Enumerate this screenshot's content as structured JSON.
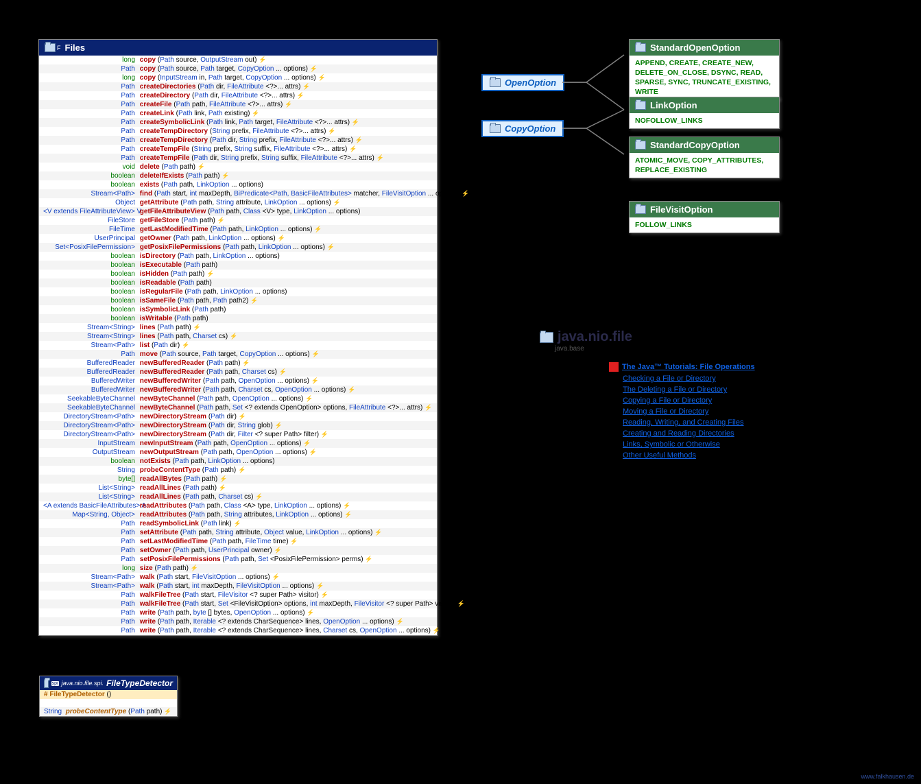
{
  "package": {
    "name": "java.nio.file",
    "module": "java.base"
  },
  "files_class": {
    "name": "Files",
    "marker": "F"
  },
  "methods": [
    {
      "ret": "long",
      "name": "copy",
      "params": [
        [
          "Path",
          "source"
        ],
        [
          "OutputStream",
          "out"
        ]
      ],
      "th": true
    },
    {
      "ret": "Path",
      "name": "copy",
      "params": [
        [
          "Path",
          "source"
        ],
        [
          "Path",
          "target"
        ],
        [
          "CopyOption",
          "... options"
        ]
      ],
      "th": true
    },
    {
      "ret": "long",
      "name": "copy",
      "params": [
        [
          "InputStream",
          "in"
        ],
        [
          "Path",
          "target"
        ],
        [
          "CopyOption",
          "... options"
        ]
      ],
      "th": true
    },
    {
      "ret": "Path",
      "name": "createDirectories",
      "params": [
        [
          "Path",
          "dir"
        ],
        [
          "FileAttribute",
          "<?>... attrs"
        ]
      ],
      "th": true
    },
    {
      "ret": "Path",
      "name": "createDirectory",
      "params": [
        [
          "Path",
          "dir"
        ],
        [
          "FileAttribute",
          "<?>... attrs"
        ]
      ],
      "th": true
    },
    {
      "ret": "Path",
      "name": "createFile",
      "params": [
        [
          "Path",
          "path"
        ],
        [
          "FileAttribute",
          "<?>... attrs"
        ]
      ],
      "th": true
    },
    {
      "ret": "Path",
      "name": "createLink",
      "params": [
        [
          "Path",
          "link"
        ],
        [
          "Path",
          "existing"
        ]
      ],
      "th": true
    },
    {
      "ret": "Path",
      "name": "createSymbolicLink",
      "params": [
        [
          "Path",
          "link"
        ],
        [
          "Path",
          "target"
        ],
        [
          "FileAttribute",
          "<?>... attrs"
        ]
      ],
      "th": true
    },
    {
      "ret": "Path",
      "name": "createTempDirectory",
      "params": [
        [
          "String",
          "prefix"
        ],
        [
          "FileAttribute",
          "<?>... attrs"
        ]
      ],
      "th": true
    },
    {
      "ret": "Path",
      "name": "createTempDirectory",
      "params": [
        [
          "Path",
          "dir"
        ],
        [
          "String",
          "prefix"
        ],
        [
          "FileAttribute",
          "<?>... attrs"
        ]
      ],
      "th": true
    },
    {
      "ret": "Path",
      "name": "createTempFile",
      "params": [
        [
          "String",
          "prefix"
        ],
        [
          "String",
          "suffix"
        ],
        [
          "FileAttribute",
          "<?>... attrs"
        ]
      ],
      "th": true
    },
    {
      "ret": "Path",
      "name": "createTempFile",
      "params": [
        [
          "Path",
          "dir"
        ],
        [
          "String",
          "prefix"
        ],
        [
          "String",
          "suffix"
        ],
        [
          "FileAttribute",
          "<?>... attrs"
        ]
      ],
      "th": true
    },
    {
      "ret": "void",
      "name": "delete",
      "params": [
        [
          "Path",
          "path"
        ]
      ],
      "th": true
    },
    {
      "ret": "boolean",
      "name": "deleteIfExists",
      "params": [
        [
          "Path",
          "path"
        ]
      ],
      "th": true
    },
    {
      "ret": "boolean",
      "name": "exists",
      "params": [
        [
          "Path",
          "path"
        ],
        [
          "LinkOption",
          "... options"
        ]
      ],
      "th": false
    },
    {
      "ret": "Stream<Path>",
      "name": "find",
      "params": [
        [
          "Path",
          "start"
        ],
        [
          "int",
          "maxDepth"
        ],
        [
          "BiPredicate<Path, BasicFileAttributes>",
          "matcher"
        ],
        [
          "FileVisitOption",
          "... options"
        ]
      ],
      "th": true
    },
    {
      "ret": "Object",
      "name": "getAttribute",
      "params": [
        [
          "Path",
          "path"
        ],
        [
          "String",
          "attribute"
        ],
        [
          "LinkOption",
          "... options"
        ]
      ],
      "th": true
    },
    {
      "ret": "<V extends FileAttributeView> V",
      "name": "getFileAttributeView",
      "params": [
        [
          "Path",
          "path"
        ],
        [
          "Class",
          "<V> type"
        ],
        [
          "LinkOption",
          "... options"
        ]
      ],
      "th": false
    },
    {
      "ret": "FileStore",
      "name": "getFileStore",
      "params": [
        [
          "Path",
          "path"
        ]
      ],
      "th": true
    },
    {
      "ret": "FileTime",
      "name": "getLastModifiedTime",
      "params": [
        [
          "Path",
          "path"
        ],
        [
          "LinkOption",
          "... options"
        ]
      ],
      "th": true
    },
    {
      "ret": "UserPrincipal",
      "name": "getOwner",
      "params": [
        [
          "Path",
          "path"
        ],
        [
          "LinkOption",
          "... options"
        ]
      ],
      "th": true
    },
    {
      "ret": "Set<PosixFilePermission>",
      "name": "getPosixFilePermissions",
      "params": [
        [
          "Path",
          "path"
        ],
        [
          "LinkOption",
          "... options"
        ]
      ],
      "th": true
    },
    {
      "ret": "boolean",
      "name": "isDirectory",
      "params": [
        [
          "Path",
          "path"
        ],
        [
          "LinkOption",
          "... options"
        ]
      ],
      "th": false
    },
    {
      "ret": "boolean",
      "name": "isExecutable",
      "params": [
        [
          "Path",
          "path"
        ]
      ],
      "th": false
    },
    {
      "ret": "boolean",
      "name": "isHidden",
      "params": [
        [
          "Path",
          "path"
        ]
      ],
      "th": true
    },
    {
      "ret": "boolean",
      "name": "isReadable",
      "params": [
        [
          "Path",
          "path"
        ]
      ],
      "th": false
    },
    {
      "ret": "boolean",
      "name": "isRegularFile",
      "params": [
        [
          "Path",
          "path"
        ],
        [
          "LinkOption",
          "... options"
        ]
      ],
      "th": false
    },
    {
      "ret": "boolean",
      "name": "isSameFile",
      "params": [
        [
          "Path",
          "path"
        ],
        [
          "Path",
          "path2"
        ]
      ],
      "th": true
    },
    {
      "ret": "boolean",
      "name": "isSymbolicLink",
      "params": [
        [
          "Path",
          "path"
        ]
      ],
      "th": false
    },
    {
      "ret": "boolean",
      "name": "isWritable",
      "params": [
        [
          "Path",
          "path"
        ]
      ],
      "th": false
    },
    {
      "ret": "Stream<String>",
      "name": "lines",
      "params": [
        [
          "Path",
          "path"
        ]
      ],
      "th": true
    },
    {
      "ret": "Stream<String>",
      "name": "lines",
      "params": [
        [
          "Path",
          "path"
        ],
        [
          "Charset",
          "cs"
        ]
      ],
      "th": true
    },
    {
      "ret": "Stream<Path>",
      "name": "list",
      "params": [
        [
          "Path",
          "dir"
        ]
      ],
      "th": true
    },
    {
      "ret": "Path",
      "name": "move",
      "params": [
        [
          "Path",
          "source"
        ],
        [
          "Path",
          "target"
        ],
        [
          "CopyOption",
          "... options"
        ]
      ],
      "th": true
    },
    {
      "ret": "BufferedReader",
      "name": "newBufferedReader",
      "params": [
        [
          "Path",
          "path"
        ]
      ],
      "th": true
    },
    {
      "ret": "BufferedReader",
      "name": "newBufferedReader",
      "params": [
        [
          "Path",
          "path"
        ],
        [
          "Charset",
          "cs"
        ]
      ],
      "th": true
    },
    {
      "ret": "BufferedWriter",
      "name": "newBufferedWriter",
      "params": [
        [
          "Path",
          "path"
        ],
        [
          "OpenOption",
          "... options"
        ]
      ],
      "th": true
    },
    {
      "ret": "BufferedWriter",
      "name": "newBufferedWriter",
      "params": [
        [
          "Path",
          "path"
        ],
        [
          "Charset",
          "cs"
        ],
        [
          "OpenOption",
          "... options"
        ]
      ],
      "th": true
    },
    {
      "ret": "SeekableByteChannel",
      "name": "newByteChannel",
      "params": [
        [
          "Path",
          "path"
        ],
        [
          "OpenOption",
          "... options"
        ]
      ],
      "th": true
    },
    {
      "ret": "SeekableByteChannel",
      "name": "newByteChannel",
      "params": [
        [
          "Path",
          "path"
        ],
        [
          "Set",
          "<? extends OpenOption> options"
        ],
        [
          "FileAttribute",
          "<?>... attrs"
        ]
      ],
      "th": true
    },
    {
      "ret": "DirectoryStream<Path>",
      "name": "newDirectoryStream",
      "params": [
        [
          "Path",
          "dir"
        ]
      ],
      "th": true
    },
    {
      "ret": "DirectoryStream<Path>",
      "name": "newDirectoryStream",
      "params": [
        [
          "Path",
          "dir"
        ],
        [
          "String",
          "glob"
        ]
      ],
      "th": true
    },
    {
      "ret": "DirectoryStream<Path>",
      "name": "newDirectoryStream",
      "params": [
        [
          "Path",
          "dir"
        ],
        [
          "Filter",
          "<? super Path> filter"
        ]
      ],
      "th": true
    },
    {
      "ret": "InputStream",
      "name": "newInputStream",
      "params": [
        [
          "Path",
          "path"
        ],
        [
          "OpenOption",
          "... options"
        ]
      ],
      "th": true
    },
    {
      "ret": "OutputStream",
      "name": "newOutputStream",
      "params": [
        [
          "Path",
          "path"
        ],
        [
          "OpenOption",
          "... options"
        ]
      ],
      "th": true
    },
    {
      "ret": "boolean",
      "name": "notExists",
      "params": [
        [
          "Path",
          "path"
        ],
        [
          "LinkOption",
          "... options"
        ]
      ],
      "th": false
    },
    {
      "ret": "String",
      "name": "probeContentType",
      "params": [
        [
          "Path",
          "path"
        ]
      ],
      "th": true
    },
    {
      "ret": "byte[]",
      "name": "readAllBytes",
      "params": [
        [
          "Path",
          "path"
        ]
      ],
      "th": true
    },
    {
      "ret": "List<String>",
      "name": "readAllLines",
      "params": [
        [
          "Path",
          "path"
        ]
      ],
      "th": true
    },
    {
      "ret": "List<String>",
      "name": "readAllLines",
      "params": [
        [
          "Path",
          "path"
        ],
        [
          "Charset",
          "cs"
        ]
      ],
      "th": true
    },
    {
      "ret": "<A extends BasicFileAttributes> A",
      "name": "readAttributes",
      "params": [
        [
          "Path",
          "path"
        ],
        [
          "Class",
          "<A> type"
        ],
        [
          "LinkOption",
          "... options"
        ]
      ],
      "th": true
    },
    {
      "ret": "Map<String, Object>",
      "name": "readAttributes",
      "params": [
        [
          "Path",
          "path"
        ],
        [
          "String",
          "attributes"
        ],
        [
          "LinkOption",
          "... options"
        ]
      ],
      "th": true
    },
    {
      "ret": "Path",
      "name": "readSymbolicLink",
      "params": [
        [
          "Path",
          "link"
        ]
      ],
      "th": true
    },
    {
      "ret": "Path",
      "name": "setAttribute",
      "params": [
        [
          "Path",
          "path"
        ],
        [
          "String",
          "attribute"
        ],
        [
          "Object",
          "value"
        ],
        [
          "LinkOption",
          "... options"
        ]
      ],
      "th": true
    },
    {
      "ret": "Path",
      "name": "setLastModifiedTime",
      "params": [
        [
          "Path",
          "path"
        ],
        [
          "FileTime",
          "time"
        ]
      ],
      "th": true
    },
    {
      "ret": "Path",
      "name": "setOwner",
      "params": [
        [
          "Path",
          "path"
        ],
        [
          "UserPrincipal",
          "owner"
        ]
      ],
      "th": true
    },
    {
      "ret": "Path",
      "name": "setPosixFilePermissions",
      "params": [
        [
          "Path",
          "path"
        ],
        [
          "Set",
          "<PosixFilePermission> perms"
        ]
      ],
      "th": true
    },
    {
      "ret": "long",
      "name": "size",
      "params": [
        [
          "Path",
          "path"
        ]
      ],
      "th": true
    },
    {
      "ret": "Stream<Path>",
      "name": "walk",
      "params": [
        [
          "Path",
          "start"
        ],
        [
          "FileVisitOption",
          "... options"
        ]
      ],
      "th": true
    },
    {
      "ret": "Stream<Path>",
      "name": "walk",
      "params": [
        [
          "Path",
          "start"
        ],
        [
          "int",
          "maxDepth"
        ],
        [
          "FileVisitOption",
          "... options"
        ]
      ],
      "th": true
    },
    {
      "ret": "Path",
      "name": "walkFileTree",
      "params": [
        [
          "Path",
          "start"
        ],
        [
          "FileVisitor",
          "<? super Path> visitor"
        ]
      ],
      "th": true
    },
    {
      "ret": "Path",
      "name": "walkFileTree",
      "params": [
        [
          "Path",
          "start"
        ],
        [
          "Set",
          "<FileVisitOption> options"
        ],
        [
          "int",
          "maxDepth"
        ],
        [
          "FileVisitor",
          "<? super Path> visitor"
        ]
      ],
      "th": true
    },
    {
      "ret": "Path",
      "name": "write",
      "params": [
        [
          "Path",
          "path"
        ],
        [
          "byte",
          "[] bytes"
        ],
        [
          "OpenOption",
          "... options"
        ]
      ],
      "th": true
    },
    {
      "ret": "Path",
      "name": "write",
      "params": [
        [
          "Path",
          "path"
        ],
        [
          "Iterable",
          "<? extends CharSequence> lines"
        ],
        [
          "OpenOption",
          "... options"
        ]
      ],
      "th": true
    },
    {
      "ret": "Path",
      "name": "write",
      "params": [
        [
          "Path",
          "path"
        ],
        [
          "Iterable",
          "<? extends CharSequence> lines"
        ],
        [
          "Charset",
          "cs"
        ],
        [
          "OpenOption",
          "... options"
        ]
      ],
      "th": true
    }
  ],
  "interfaces": [
    {
      "name": "OpenOption"
    },
    {
      "name": "CopyOption"
    }
  ],
  "enums": [
    {
      "name": "StandardOpenOption",
      "values": "APPEND, CREATE, CREATE_NEW, DELETE_ON_CLOSE, DSYNC, READ, SPARSE, SYNC, TRUNCATE_EXISTING, WRITE"
    },
    {
      "name": "LinkOption",
      "values": "NOFOLLOW_LINKS"
    },
    {
      "name": "StandardCopyOption",
      "values": "ATOMIC_MOVE, COPY_ATTRIBUTES, REPLACE_EXISTING"
    },
    {
      "name": "FileVisitOption",
      "values": "FOLLOW_LINKS"
    }
  ],
  "tutorial": {
    "header": "The Java™ Tutorials: File Operations",
    "links": [
      "Checking a File or Directory",
      "The Deleting a File or Directory",
      "Copying a File or Directory",
      "Moving a File or Directory",
      "Reading, Writing, and Creating Files",
      "Creating and Reading Directories",
      "Links, Symbolic or Otherwise",
      "Other Useful Methods"
    ]
  },
  "ftd": {
    "pkg": "java.nio.file.spi.",
    "name": "FileTypeDetector",
    "ctor": "FileTypeDetector",
    "method_ret": "String",
    "method_name": "probeContentType",
    "method_param_type": "Path",
    "method_param_name": "path"
  },
  "footer": "www.falkhausen.de"
}
